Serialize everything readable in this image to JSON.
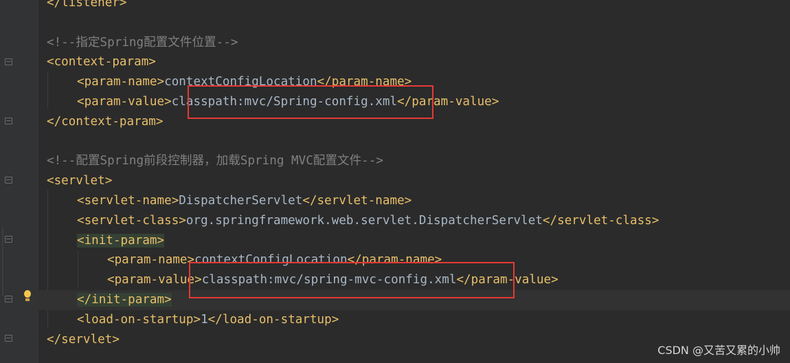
{
  "editor": {
    "lines": [
      {
        "parts": [
          {
            "t": "tag",
            "v": "</listener>"
          }
        ]
      },
      {
        "parts": []
      },
      {
        "parts": [
          {
            "t": "comment",
            "v": "<!--指定Spring配置文件位置-->"
          }
        ]
      },
      {
        "parts": [
          {
            "t": "tag",
            "v": "<context-param>"
          }
        ]
      },
      {
        "parts": [
          {
            "t": "tag",
            "v": "<param-name>"
          },
          {
            "t": "txt",
            "v": "contextConfigLocation"
          },
          {
            "t": "tag",
            "v": "</param-name>"
          }
        ]
      },
      {
        "parts": [
          {
            "t": "tag",
            "v": "<param-value>"
          },
          {
            "t": "txt",
            "v": "classpath:mvc/Spring-config.xml"
          },
          {
            "t": "tag",
            "v": "</param-value>"
          }
        ]
      },
      {
        "parts": [
          {
            "t": "tag",
            "v": "</context-param>"
          }
        ]
      },
      {
        "parts": []
      },
      {
        "parts": [
          {
            "t": "comment",
            "v": "<!--配置Spring前段控制器，加载Spring MVC配置文件-->"
          }
        ]
      },
      {
        "parts": [
          {
            "t": "tag",
            "v": "<servlet>"
          }
        ]
      },
      {
        "parts": [
          {
            "t": "tag",
            "v": "<servlet-name>"
          },
          {
            "t": "txt",
            "v": "DispatcherServlet"
          },
          {
            "t": "tag",
            "v": "</servlet-name>"
          }
        ]
      },
      {
        "parts": [
          {
            "t": "tag",
            "v": "<servlet-class>"
          },
          {
            "t": "txt",
            "v": "org.springframework.web.servlet.DispatcherServlet"
          },
          {
            "t": "tag",
            "v": "</servlet-class>"
          }
        ]
      },
      {
        "parts": [
          {
            "t": "tag",
            "v": "<init-param>",
            "hl": true
          }
        ]
      },
      {
        "parts": [
          {
            "t": "tag",
            "v": "<param-name>"
          },
          {
            "t": "txt",
            "v": "contextConfigLocation"
          },
          {
            "t": "tag",
            "v": "</param-name>"
          }
        ]
      },
      {
        "parts": [
          {
            "t": "tag",
            "v": "<param-value>"
          },
          {
            "t": "txt",
            "v": "classpath:mvc/spring-mvc-config.xml"
          },
          {
            "t": "tag",
            "v": "</param-value>"
          }
        ]
      },
      {
        "parts": [
          {
            "t": "tag",
            "v": "</init-param>",
            "hl": true
          }
        ]
      },
      {
        "parts": [
          {
            "t": "tag",
            "v": "<load-on-startup>"
          },
          {
            "t": "txt",
            "v": "1"
          },
          {
            "t": "tag",
            "v": "</load-on-startup>"
          }
        ]
      },
      {
        "parts": [
          {
            "t": "tag",
            "v": "</servlet>"
          }
        ]
      }
    ]
  },
  "gutter": {
    "intention_icon": "lightbulb-icon",
    "fold_icon": "fold-marker-icon"
  },
  "colors": {
    "background": "#2b2b2b",
    "tag": "#e8bf6a",
    "text": "#a9b7c6",
    "comment": "#808080",
    "annotation_box": "#e53935"
  },
  "watermark": "CSDN @又苦又累的小帅"
}
